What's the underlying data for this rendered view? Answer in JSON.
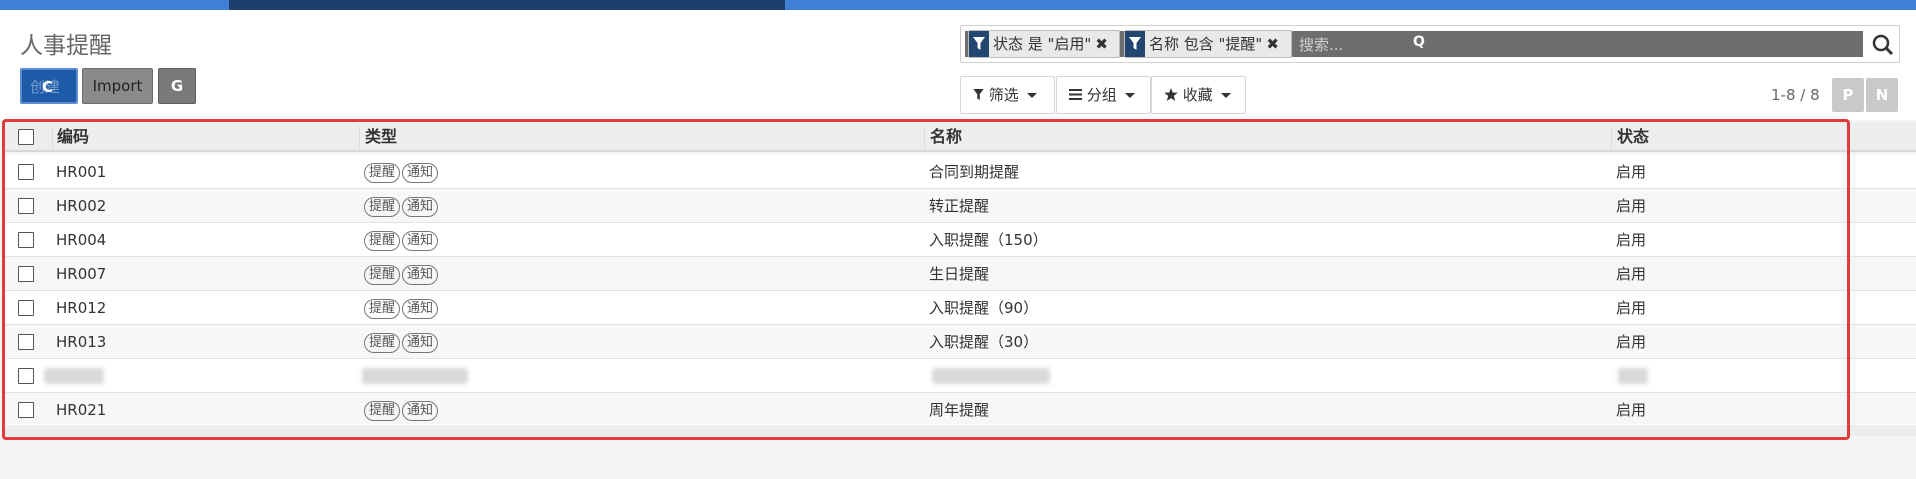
{
  "title": "人事提醒",
  "buttons": {
    "create": "创建",
    "create_overlay": "C",
    "import": "Import",
    "g": "G"
  },
  "search": {
    "facets": [
      {
        "label": "状态 是 \"启用\""
      },
      {
        "label": "名称 包含 \"提醒\""
      }
    ],
    "placeholder": "搜索...",
    "q_glyph": "Q"
  },
  "filters": {
    "filter": "筛选",
    "group": "分组",
    "favorite": "收藏"
  },
  "pager": {
    "range": "1-8 / 8",
    "prev": "P",
    "next": "N"
  },
  "table": {
    "headers": [
      "编码",
      "类型",
      "名称",
      "状态"
    ],
    "rows": [
      {
        "code": "HR001",
        "tags": [
          "提醒",
          "通知"
        ],
        "name": "合同到期提醒",
        "status": "启用"
      },
      {
        "code": "HR002",
        "tags": [
          "提醒",
          "通知"
        ],
        "name": "转正提醒",
        "status": "启用"
      },
      {
        "code": "HR004",
        "tags": [
          "提醒",
          "通知"
        ],
        "name": "入职提醒（150）",
        "status": "启用"
      },
      {
        "code": "HR007",
        "tags": [
          "提醒",
          "通知"
        ],
        "name": "生日提醒",
        "status": "启用"
      },
      {
        "code": "HR012",
        "tags": [
          "提醒",
          "通知"
        ],
        "name": "入职提醒（90）",
        "status": "启用"
      },
      {
        "code": "HR013",
        "tags": [
          "提醒",
          "通知"
        ],
        "name": "入职提醒（30）",
        "status": "启用"
      },
      {
        "code": "",
        "tags": [],
        "name": "",
        "status": ""
      },
      {
        "code": "HR021",
        "tags": [
          "提醒",
          "通知"
        ],
        "name": "周年提醒",
        "status": "启用"
      }
    ]
  },
  "colors": {
    "accent": "#3f7fd6",
    "highlight": "#e23b3b",
    "facet_icon": "#21466f"
  }
}
